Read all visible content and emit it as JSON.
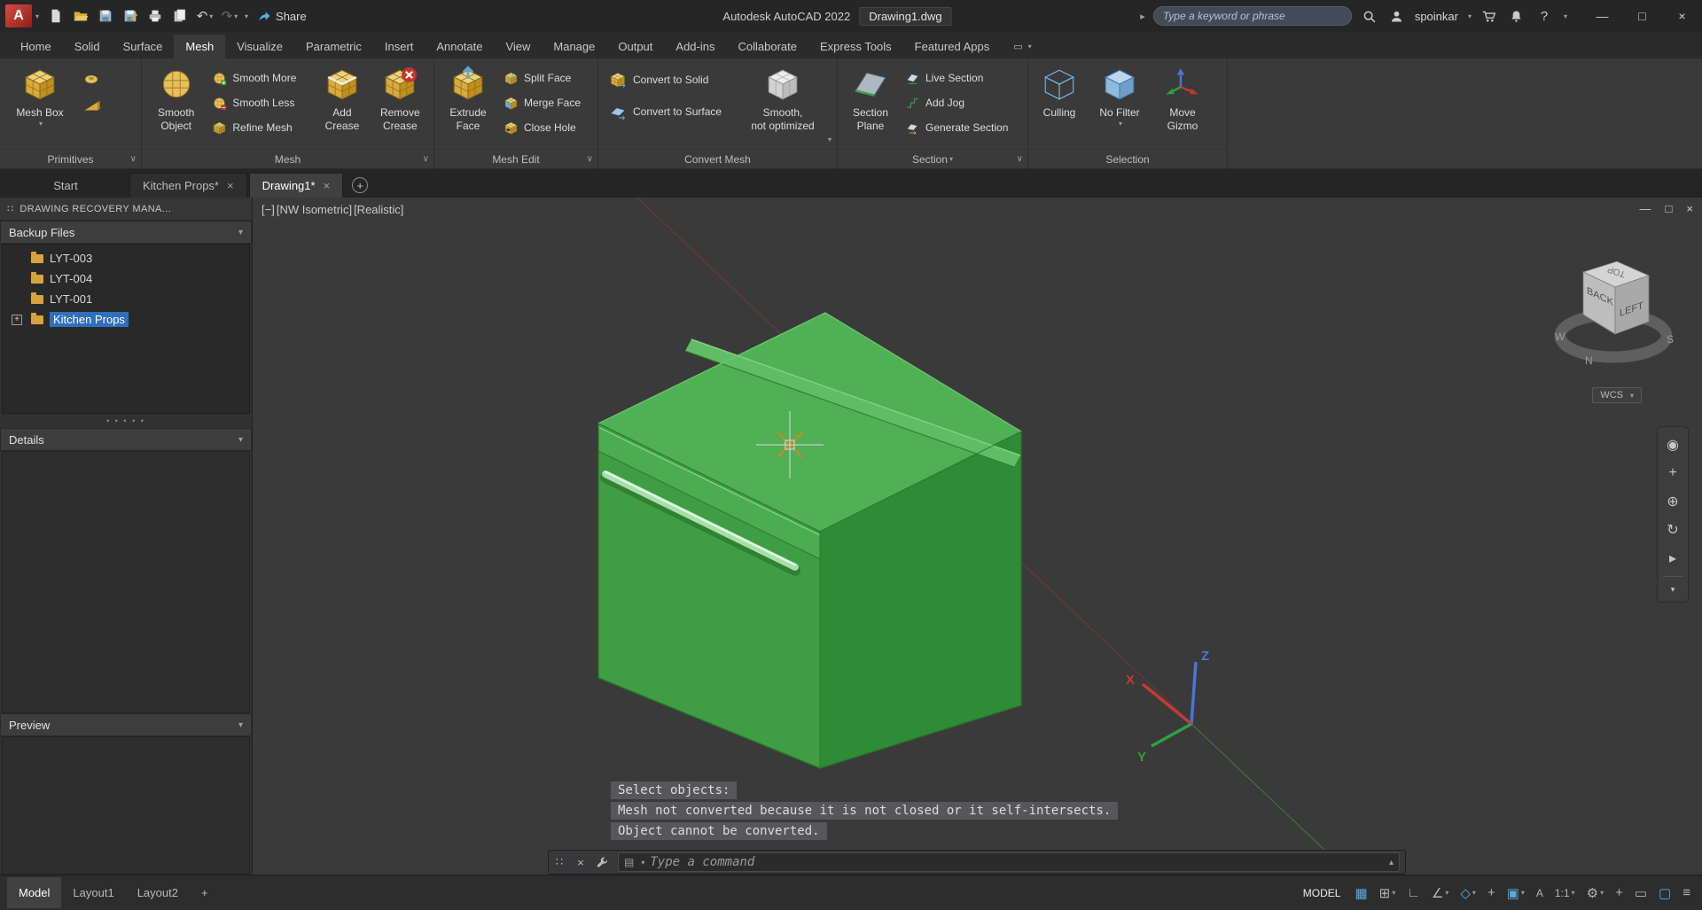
{
  "glyphs": {
    "caret_down": "▾",
    "caret_right": "▸",
    "caret_up": "▴",
    "chevron_down": "∨",
    "minimize": "—",
    "maximize": "□",
    "restore": "□",
    "close": "×",
    "plus": "+",
    "grip": "∷",
    "dots": "• • • • •",
    "undo": "↶",
    "redo": "↷",
    "help": "?",
    "ribbon_toggle": "▭"
  },
  "titlebar": {
    "logo_letter": "A",
    "share_label": "Share",
    "app_title": "Autodesk AutoCAD 2022",
    "doc_title": "Drawing1.dwg",
    "search_placeholder": "Type a keyword or phrase",
    "username": "spoinkar"
  },
  "ribbon_tabs": [
    {
      "label": "Home"
    },
    {
      "label": "Solid"
    },
    {
      "label": "Surface"
    },
    {
      "label": "Mesh"
    },
    {
      "label": "Visualize"
    },
    {
      "label": "Parametric"
    },
    {
      "label": "Insert"
    },
    {
      "label": "Annotate"
    },
    {
      "label": "View"
    },
    {
      "label": "Manage"
    },
    {
      "label": "Output"
    },
    {
      "label": "Add-ins"
    },
    {
      "label": "Collaborate"
    },
    {
      "label": "Express Tools"
    },
    {
      "label": "Featured Apps"
    }
  ],
  "panels": {
    "primitives": {
      "label": "Primitives",
      "mesh_box": "Mesh Box"
    },
    "mesh": {
      "label": "Mesh",
      "smooth_object_1": "Smooth",
      "smooth_object_2": "Object",
      "smooth_more": "Smooth More",
      "smooth_less": "Smooth Less",
      "refine_mesh": "Refine Mesh",
      "add_crease_1": "Add",
      "add_crease_2": "Crease",
      "remove_crease_1": "Remove",
      "remove_crease_2": "Crease"
    },
    "mesh_edit": {
      "label": "Mesh Edit",
      "extrude_1": "Extrude",
      "extrude_2": "Face",
      "split_face": "Split Face",
      "merge_face": "Merge Face",
      "close_hole": "Close Hole"
    },
    "convert": {
      "label": "Convert Mesh",
      "to_solid": "Convert to Solid",
      "to_surface": "Convert to Surface",
      "smooth_1": "Smooth,",
      "smooth_2": "not optimized"
    },
    "section": {
      "label": "Section",
      "plane_1": "Section",
      "plane_2": "Plane",
      "live_section": "Live Section",
      "add_jog": "Add Jog",
      "generate_section": "Generate Section"
    },
    "selection": {
      "label": "Selection",
      "culling": "Culling",
      "no_filter": "No Filter",
      "gizmo_1": "Move",
      "gizmo_2": "Gizmo"
    }
  },
  "filetabs": {
    "start": "Start",
    "kitchen": "Kitchen Props*",
    "drawing": "Drawing1*"
  },
  "palette": {
    "title": "DRAWING RECOVERY MANA...",
    "backup_header": "Backup Files",
    "details_header": "Details",
    "preview_header": "Preview",
    "tree": [
      {
        "label": "LYT-003"
      },
      {
        "label": "LYT-004"
      },
      {
        "label": "LYT-001"
      },
      {
        "label": "Kitchen Props"
      }
    ]
  },
  "viewport": {
    "controls": "[−]",
    "view_name": "[NW Isometric]",
    "visual_style": "[Realistic]",
    "viewcube": {
      "top": "TOP",
      "back": "BACK",
      "left": "LEFT",
      "w": "W",
      "n": "N",
      "s": "S",
      "wcs": "WCS"
    },
    "axis": {
      "x": "X",
      "y": "Y",
      "z": "Z"
    },
    "navbar": [
      {
        "name": "navigation-wheel",
        "glyph": "◉"
      },
      {
        "name": "pan",
        "glyph": "+"
      },
      {
        "name": "zoom",
        "glyph": "⊕"
      },
      {
        "name": "orbit",
        "glyph": "↻"
      },
      {
        "name": "show-motion",
        "glyph": "▸"
      }
    ],
    "history": [
      "Select objects:",
      "Mesh not converted because it is not closed or it self-intersects.",
      "Object cannot be converted."
    ],
    "command_placeholder": "Type a command"
  },
  "statusbar": {
    "model_tab": "Model",
    "layout1_tab": "Layout1",
    "layout2_tab": "Layout2",
    "model_space": "MODEL",
    "icons": [
      {
        "name": "grid-display",
        "glyph": "▦"
      },
      {
        "name": "snap-mode",
        "glyph": "⊞"
      },
      {
        "name": "ortho-mode",
        "glyph": "∟"
      },
      {
        "name": "polar-tracking",
        "glyph": "∠"
      },
      {
        "name": "isometric-drafting",
        "glyph": "◇"
      },
      {
        "name": "object-snap-tracking",
        "glyph": "+"
      },
      {
        "name": "object-snap",
        "glyph": "▣"
      },
      {
        "name": "annotation-visibility",
        "glyph": "A"
      },
      {
        "name": "annotation-scale",
        "glyph": "1:1"
      },
      {
        "name": "workspace",
        "glyph": "⚙"
      },
      {
        "name": "annotation-monitor",
        "glyph": "+"
      },
      {
        "name": "isolate-objects",
        "glyph": "▭"
      },
      {
        "name": "graphics-performance",
        "glyph": "▢"
      },
      {
        "name": "customize",
        "glyph": "≡"
      }
    ]
  }
}
